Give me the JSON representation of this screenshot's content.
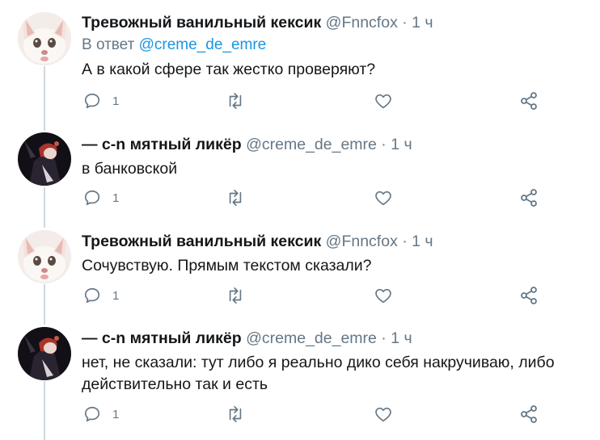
{
  "thread": [
    {
      "avatar": "fox-avatar",
      "name": "Тревожный ванильный кексик",
      "handle": "@Fnncfox",
      "dot": "·",
      "time": "1 ч",
      "reply_prefix": "В ответ",
      "reply_mention": "@creme_de_emre",
      "text": [
        "А в какой сфере так жестко проверяют?"
      ],
      "reply_count": "1"
    },
    {
      "avatar": "dark-avatar",
      "name": "— c-n мятный ликёр",
      "handle": "@creme_de_emre",
      "dot": "·",
      "time": "1 ч",
      "text": [
        "в банковской"
      ],
      "reply_count": "1"
    },
    {
      "avatar": "fox-avatar",
      "name": "Тревожный ванильный кексик",
      "handle": "@Fnncfox",
      "dot": "·",
      "time": "1 ч",
      "text": [
        "Сочувствую. Прямым текстом сказали?"
      ],
      "reply_count": "1"
    },
    {
      "avatar": "dark-avatar",
      "name": "— c-n мятный ликёр",
      "handle": "@creme_de_emre",
      "dot": "·",
      "time": "1 ч",
      "text": [
        "нет, не сказали: тут либо я реально дико себя накручиваю, либо",
        "действительно так и есть"
      ],
      "reply_count": "1"
    }
  ],
  "colors": {
    "text": "#14171a",
    "secondary": "#657786",
    "link": "#1b95e0",
    "thread_line": "#cfd9de"
  },
  "icons": [
    "reply-icon",
    "retweet-icon",
    "like-icon",
    "share-icon"
  ]
}
